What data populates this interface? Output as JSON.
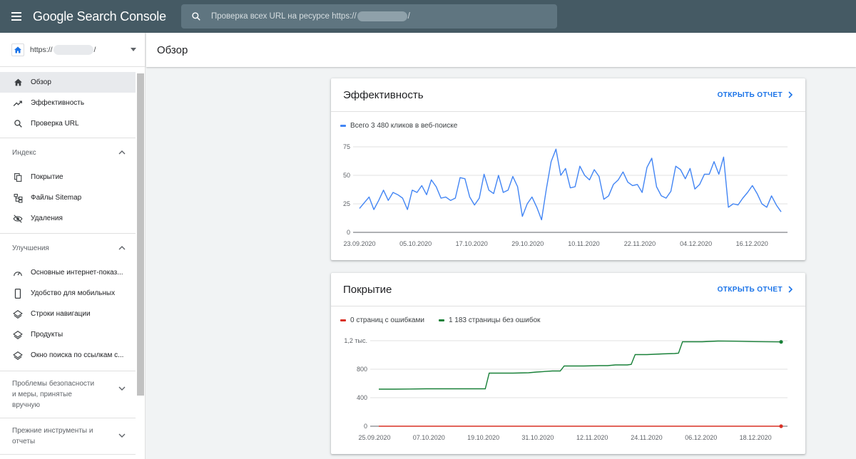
{
  "app": {
    "title": "Google Search Console",
    "search_placeholder_pre": "Проверка всех URL на ресурсе https://",
    "search_placeholder_post": "/"
  },
  "property": {
    "prefix": "https://",
    "suffix": "/"
  },
  "sidebar": {
    "top_items": [
      {
        "label": "Обзор",
        "icon": "home-icon",
        "active": true
      },
      {
        "label": "Эффективность",
        "icon": "trending-up-icon"
      },
      {
        "label": "Проверка URL",
        "icon": "search-icon"
      }
    ],
    "index": {
      "heading": "Индекс",
      "items": [
        {
          "label": "Покрытие",
          "icon": "file-copy-icon"
        },
        {
          "label": "Файлы Sitemap",
          "icon": "sitemap-icon"
        },
        {
          "label": "Удаления",
          "icon": "visibility-off-icon"
        }
      ]
    },
    "enhancements": {
      "heading": "Улучшения",
      "items": [
        {
          "label": "Основные интернет-показ...",
          "icon": "speed-icon"
        },
        {
          "label": "Удобство для мобильных",
          "icon": "smartphone-icon"
        },
        {
          "label": "Строки навигации",
          "icon": "layers-icon"
        },
        {
          "label": "Продукты",
          "icon": "layers-icon"
        },
        {
          "label": "Окно поиска по ссылкам с...",
          "icon": "layers-icon"
        }
      ]
    },
    "security": {
      "line1": "Проблемы безопасности",
      "line2": "и меры, принятые",
      "line3": "вручную"
    },
    "legacy": {
      "line1": "Прежние инструменты и",
      "line2": "отчеты"
    }
  },
  "main": {
    "title": "Обзор"
  },
  "performance": {
    "title": "Эффективность",
    "open_report": "ОТКРЫТЬ ОТЧЕТ",
    "legend": "Всего 3 480 кликов в веб-поиске",
    "color": "#4285f4",
    "chart_data": {
      "type": "line",
      "ylim": [
        0,
        75
      ],
      "y_ticks": [
        "75",
        "50",
        "25",
        "0"
      ],
      "x_ticks": [
        "23.09.2020",
        "05.10.2020",
        "17.10.2020",
        "29.10.2020",
        "10.11.2020",
        "22.11.2020",
        "04.12.2020",
        "16.12.2020"
      ],
      "x_start": "2020-09-23",
      "series": [
        {
          "name": "Всего 3 480 кликов в веб-поиске",
          "values": [
            21,
            26,
            31,
            20,
            28,
            37,
            28,
            35,
            33,
            30,
            20,
            37,
            35,
            41,
            33,
            46,
            40,
            30,
            31,
            28,
            30,
            48,
            47,
            31,
            24,
            30,
            51,
            37,
            34,
            50,
            35,
            37,
            49,
            40,
            14,
            25,
            31,
            22,
            11,
            38,
            62,
            73,
            50,
            56,
            39,
            40,
            58,
            50,
            46,
            55,
            49,
            29,
            32,
            42,
            46,
            53,
            44,
            41,
            42,
            35,
            57,
            65,
            40,
            32,
            30,
            36,
            58,
            55,
            47,
            56,
            38,
            42,
            51,
            51,
            62,
            51,
            66,
            22,
            25,
            24,
            30,
            35,
            41,
            34,
            25,
            22,
            32,
            24,
            18
          ]
        }
      ]
    }
  },
  "coverage": {
    "title": "Покрытие",
    "open_report": "ОТКРЫТЬ ОТЧЕТ",
    "legend_errors": "0 страниц с ошибками",
    "legend_valid": "1 183 страницы без ошибок",
    "error_color": "#d93025",
    "valid_color": "#188038",
    "chart_data": {
      "type": "line",
      "ylim": [
        0,
        1200
      ],
      "y_ticks": [
        "1,2 тыс.",
        "800",
        "400",
        "0"
      ],
      "x_ticks": [
        "25.09.2020",
        "07.10.2020",
        "19.10.2020",
        "31.10.2020",
        "12.11.2020",
        "24.11.2020",
        "06.12.2020",
        "18.12.2020"
      ],
      "x_start": "2020-09-25",
      "series": [
        {
          "name": "1 183 страницы без ошибок",
          "points": [
            [
              0,
              520
            ],
            [
              1,
              520
            ],
            [
              4,
              520
            ],
            [
              8,
              522
            ],
            [
              12,
              525
            ],
            [
              16,
              525
            ],
            [
              20,
              525
            ],
            [
              24,
              525
            ],
            [
              27,
              525
            ],
            [
              28,
              745
            ],
            [
              34,
              745
            ],
            [
              38,
              750
            ],
            [
              40,
              760
            ],
            [
              44,
              775
            ],
            [
              46,
              775
            ],
            [
              47,
              845
            ],
            [
              52,
              845
            ],
            [
              56,
              850
            ],
            [
              58,
              850
            ],
            [
              60,
              860
            ],
            [
              63,
              860
            ],
            [
              64,
              868
            ],
            [
              65,
              1005
            ],
            [
              68,
              1005
            ],
            [
              72,
              1015
            ],
            [
              75,
              1020
            ],
            [
              76,
              1025
            ],
            [
              77,
              1185
            ],
            [
              82,
              1185
            ],
            [
              84,
              1190
            ],
            [
              86,
              1195
            ],
            [
              90,
              1193
            ],
            [
              95,
              1187
            ],
            [
              102,
              1183
            ]
          ]
        },
        {
          "name": "0 страниц с ошибками",
          "points": [
            [
              0,
              0
            ],
            [
              102,
              0
            ]
          ]
        }
      ]
    }
  }
}
